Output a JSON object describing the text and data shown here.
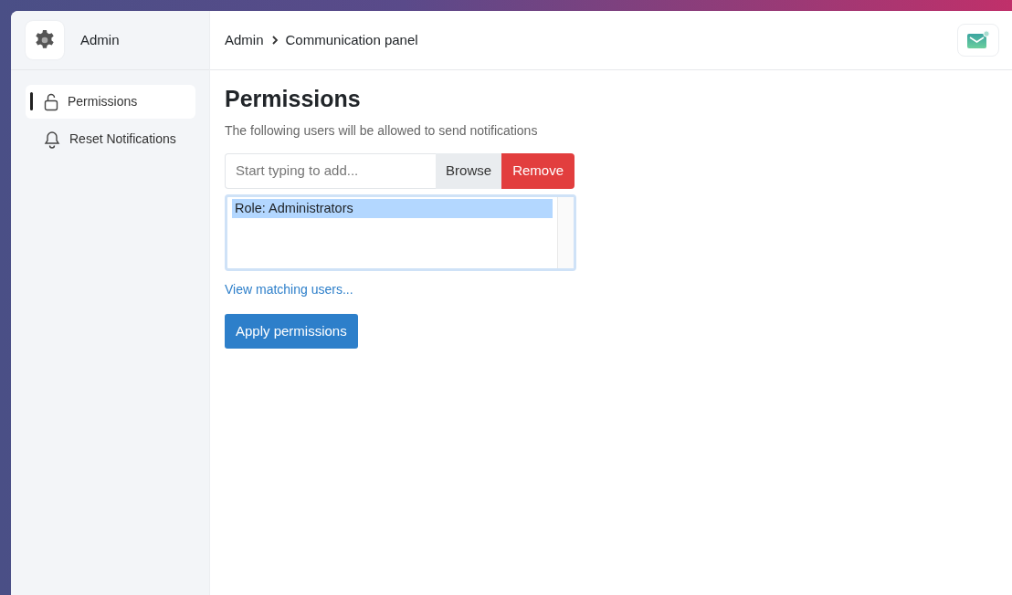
{
  "sidebar": {
    "title": "Admin",
    "items": [
      {
        "label": "Permissions",
        "kind": "lock",
        "selected": true
      },
      {
        "label": "Reset Notifications",
        "kind": "bell",
        "selected": false
      }
    ]
  },
  "breadcrumb": [
    "Admin",
    "Communication panel"
  ],
  "header": {
    "mail_unread": true
  },
  "page": {
    "heading": "Permissions",
    "description": "The following users will be allowed to send notifications",
    "search": {
      "placeholder": "Start typing to add..."
    },
    "buttons": [
      {
        "label": "Browse",
        "kind": "secondary"
      },
      {
        "label": "Remove",
        "kind": "danger"
      }
    ],
    "list": [
      {
        "label": "Role: Administrators",
        "selected": true
      }
    ],
    "link": "View matching users...",
    "submit": "Apply permissions"
  }
}
